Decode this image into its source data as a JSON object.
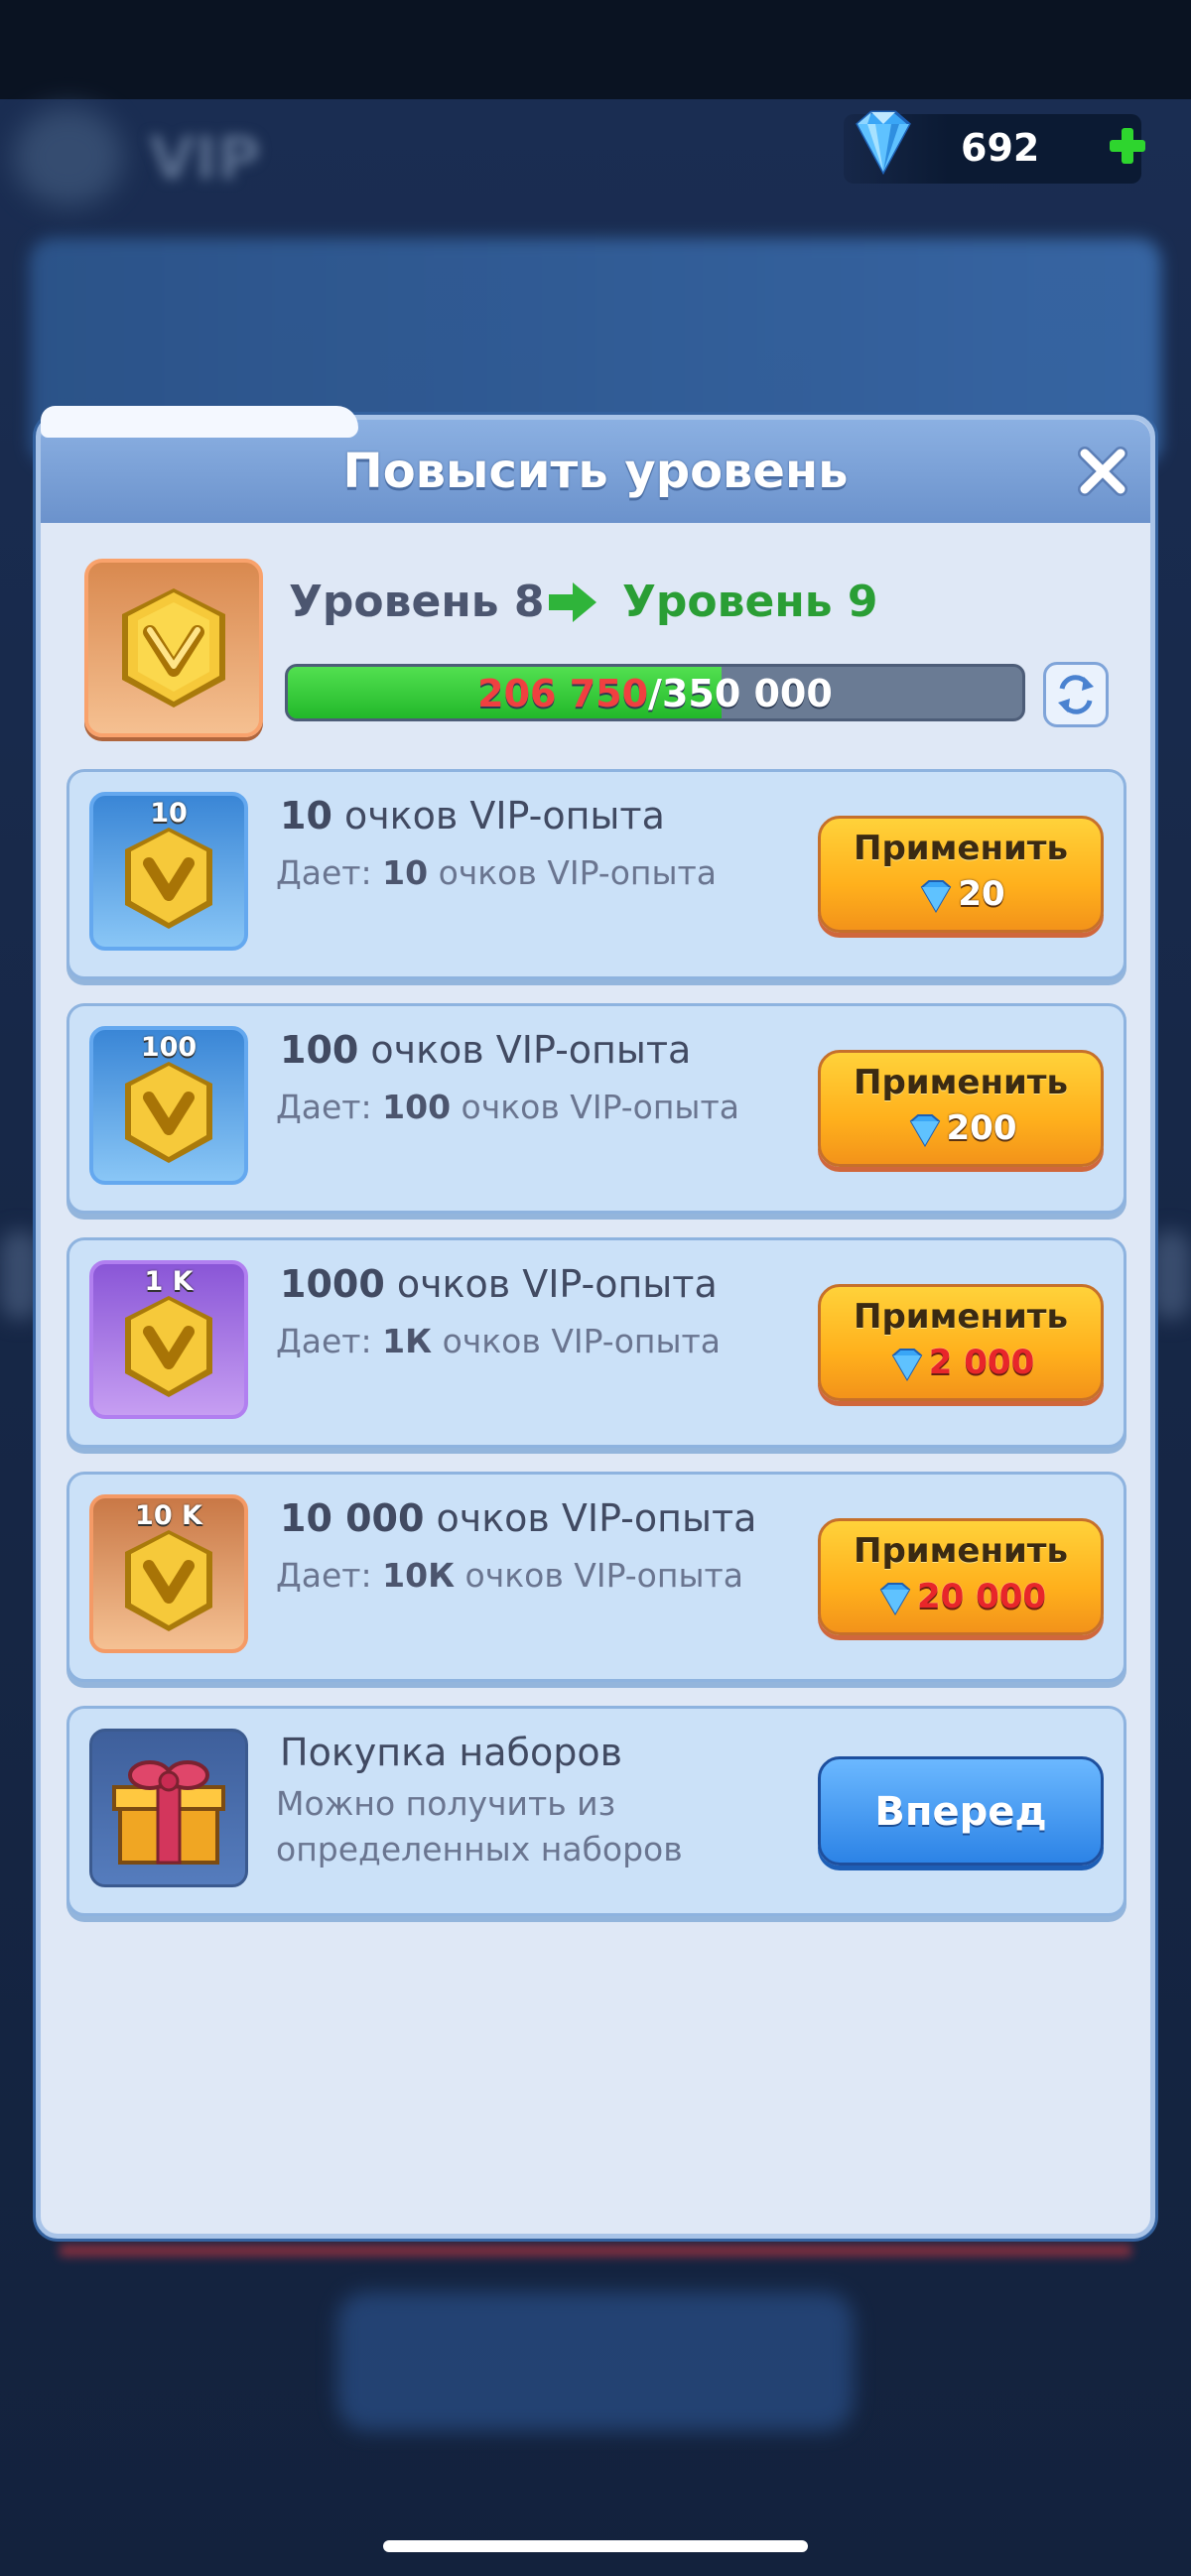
{
  "currency": {
    "gems": "692"
  },
  "modal": {
    "title": "Повысить уровень",
    "level_prefix": "Уровень",
    "current_level": "8",
    "next_level_prefix": "Уровень",
    "next_level": "9",
    "progress": {
      "current": "206 750",
      "separator": "/",
      "max": "350 000",
      "fraction": 0.5907
    }
  },
  "items": [
    {
      "badge": "10",
      "title_num": "10",
      "title_rest": " очков VIP-опыта",
      "desc_prefix": "Дает: ",
      "desc_num": "10",
      "desc_rest": " очков VIP-опыта",
      "button": "Применить",
      "cost": "20"
    },
    {
      "badge": "100",
      "title_num": "100",
      "title_rest": " очков VIP-опыта",
      "desc_prefix": "Дает: ",
      "desc_num": "100",
      "desc_rest": " очков VIP-опыта",
      "button": "Применить",
      "cost": "200"
    },
    {
      "badge": "1 K",
      "title_num": "1000",
      "title_rest": " очков VIP-опыта",
      "desc_prefix": "Дает: ",
      "desc_num": "1К",
      "desc_rest": " очков VIP-опыта",
      "button": "Применить",
      "cost": "2 000"
    },
    {
      "badge": "10 K",
      "title_num": "10 000",
      "title_rest": " очков VIP-опыта",
      "desc_prefix": "Дает: ",
      "desc_num": "10К",
      "desc_rest": " очков VIP-опыта",
      "button": "Применить",
      "cost": "20 000"
    }
  ],
  "bundle": {
    "title": "Покупка наборов",
    "desc_line1": "Можно получить из",
    "desc_line2": "определенных наборов",
    "button": "Вперед"
  }
}
